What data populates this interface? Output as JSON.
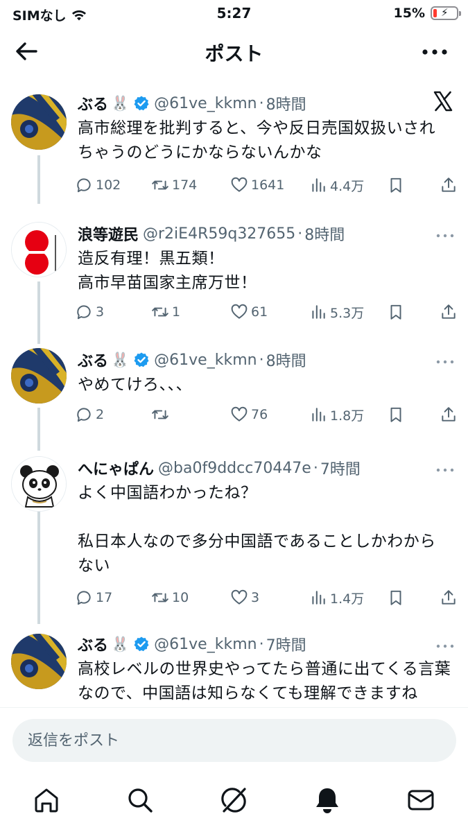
{
  "status_bar": {
    "carrier": "SIMなし",
    "time": "5:27",
    "battery_percent": "15%",
    "battery_level": 0.15,
    "battery_color": "#ff3b30"
  },
  "header": {
    "title": "ポスト",
    "back_icon": "arrow-left-icon",
    "more_icon": "more-horizontal-icon"
  },
  "posts": [
    {
      "name": "ぶる",
      "emoji": "🐰",
      "verified": true,
      "handle": "@61ve_kkmn",
      "time": "8時間",
      "text": "高市総理を批判すると、今や反日売国奴扱いされちゃうのどうにかならないんかな",
      "replies": "102",
      "reposts": "174",
      "likes": "1641",
      "views": "4.4万"
    },
    {
      "name": "浪等遊民",
      "emoji": "",
      "verified": false,
      "handle": "@r2iE4R59q327655",
      "time": "8時間",
      "text": "造反有理！黒五類！\n高市早苗国家主席万世！",
      "replies": "3",
      "reposts": "1",
      "likes": "61",
      "views": "5.3万"
    },
    {
      "name": "ぶる",
      "emoji": "🐰",
      "verified": true,
      "handle": "@61ve_kkmn",
      "time": "8時間",
      "text": "やめてけろ、、、",
      "replies": "2",
      "reposts": "",
      "likes": "76",
      "views": "1.8万"
    },
    {
      "name": "へにゃぱん",
      "emoji": "",
      "verified": false,
      "handle": "@ba0f9ddcc70447e",
      "time": "7時間",
      "text": "よく中国語わかったね？\n\n私日本人なので多分中国語であることしかわからない",
      "replies": "17",
      "reposts": "10",
      "likes": "3",
      "views": "1.4万"
    },
    {
      "name": "ぶる",
      "emoji": "🐰",
      "verified": true,
      "handle": "@61ve_kkmn",
      "time": "7時間",
      "text": "高校レベルの世界史やってたら普通に出てくる言葉なので、中国語は知らなくても理解できますね"
    }
  ],
  "reply_bar": {
    "placeholder": "返信をポスト"
  },
  "tabs": [
    "home-icon",
    "search-icon",
    "grok-icon",
    "notifications-icon",
    "messages-icon"
  ],
  "colors": {
    "verified": "#1d9bf0",
    "secondary_text": "#536471",
    "thread_line": "#cfd9de"
  }
}
